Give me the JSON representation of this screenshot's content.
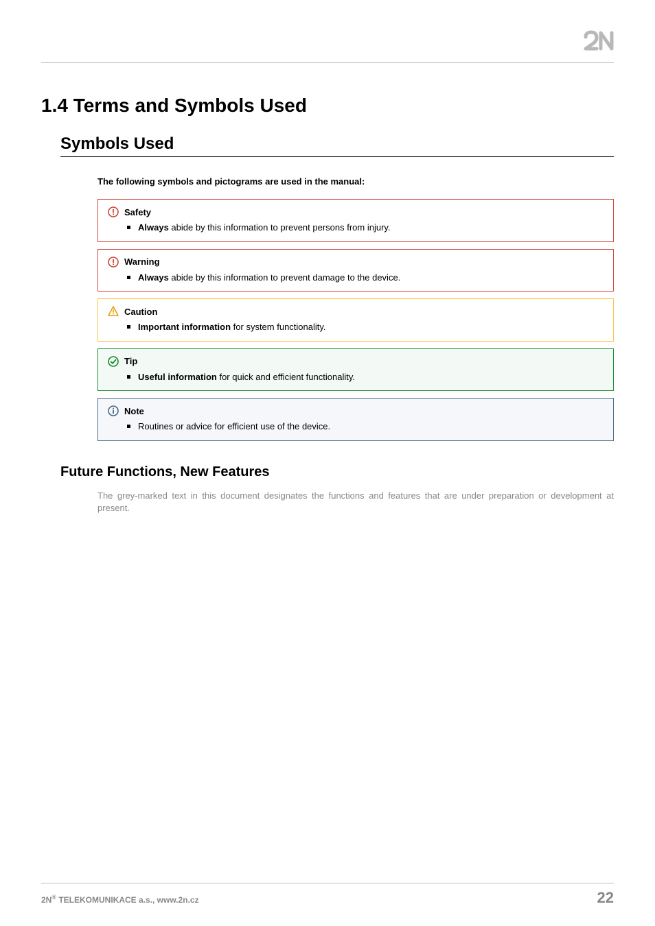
{
  "header": {
    "logo_label": "2N"
  },
  "title": "1.4 Terms and Symbols Used",
  "subtitle": "Symbols Used",
  "intro": "The following symbols and pictograms are used in the manual:",
  "callouts": [
    {
      "kind": "safety",
      "title": "Safety",
      "body_prefix_bold": "Always",
      "body_rest": "  abide by this information to prevent persons from injury."
    },
    {
      "kind": "warning",
      "title": "Warning",
      "body_prefix_bold": "Always",
      "body_rest": " abide by this information to prevent damage to the device."
    },
    {
      "kind": "caution",
      "title": "Caution",
      "body_prefix_bold": "Important information",
      "body_rest": " for system functionality."
    },
    {
      "kind": "tip",
      "title": "Tip",
      "body_prefix_bold": "Useful information",
      "body_rest": " for quick and efficient functionality."
    },
    {
      "kind": "note",
      "title": "Note",
      "body_prefix_bold": "",
      "body_rest": "Routines or advice for efficient use of the device."
    }
  ],
  "subsection2": "Future Functions, New Features",
  "grey_note": "The grey-marked text in this document designates the functions and features that are under preparation or development at present.",
  "footer": {
    "left_prefix": "2N",
    "left_sup": "®",
    "left_rest": " TELEKOMUNIKACE a.s., www.2n.cz",
    "page": "22"
  }
}
